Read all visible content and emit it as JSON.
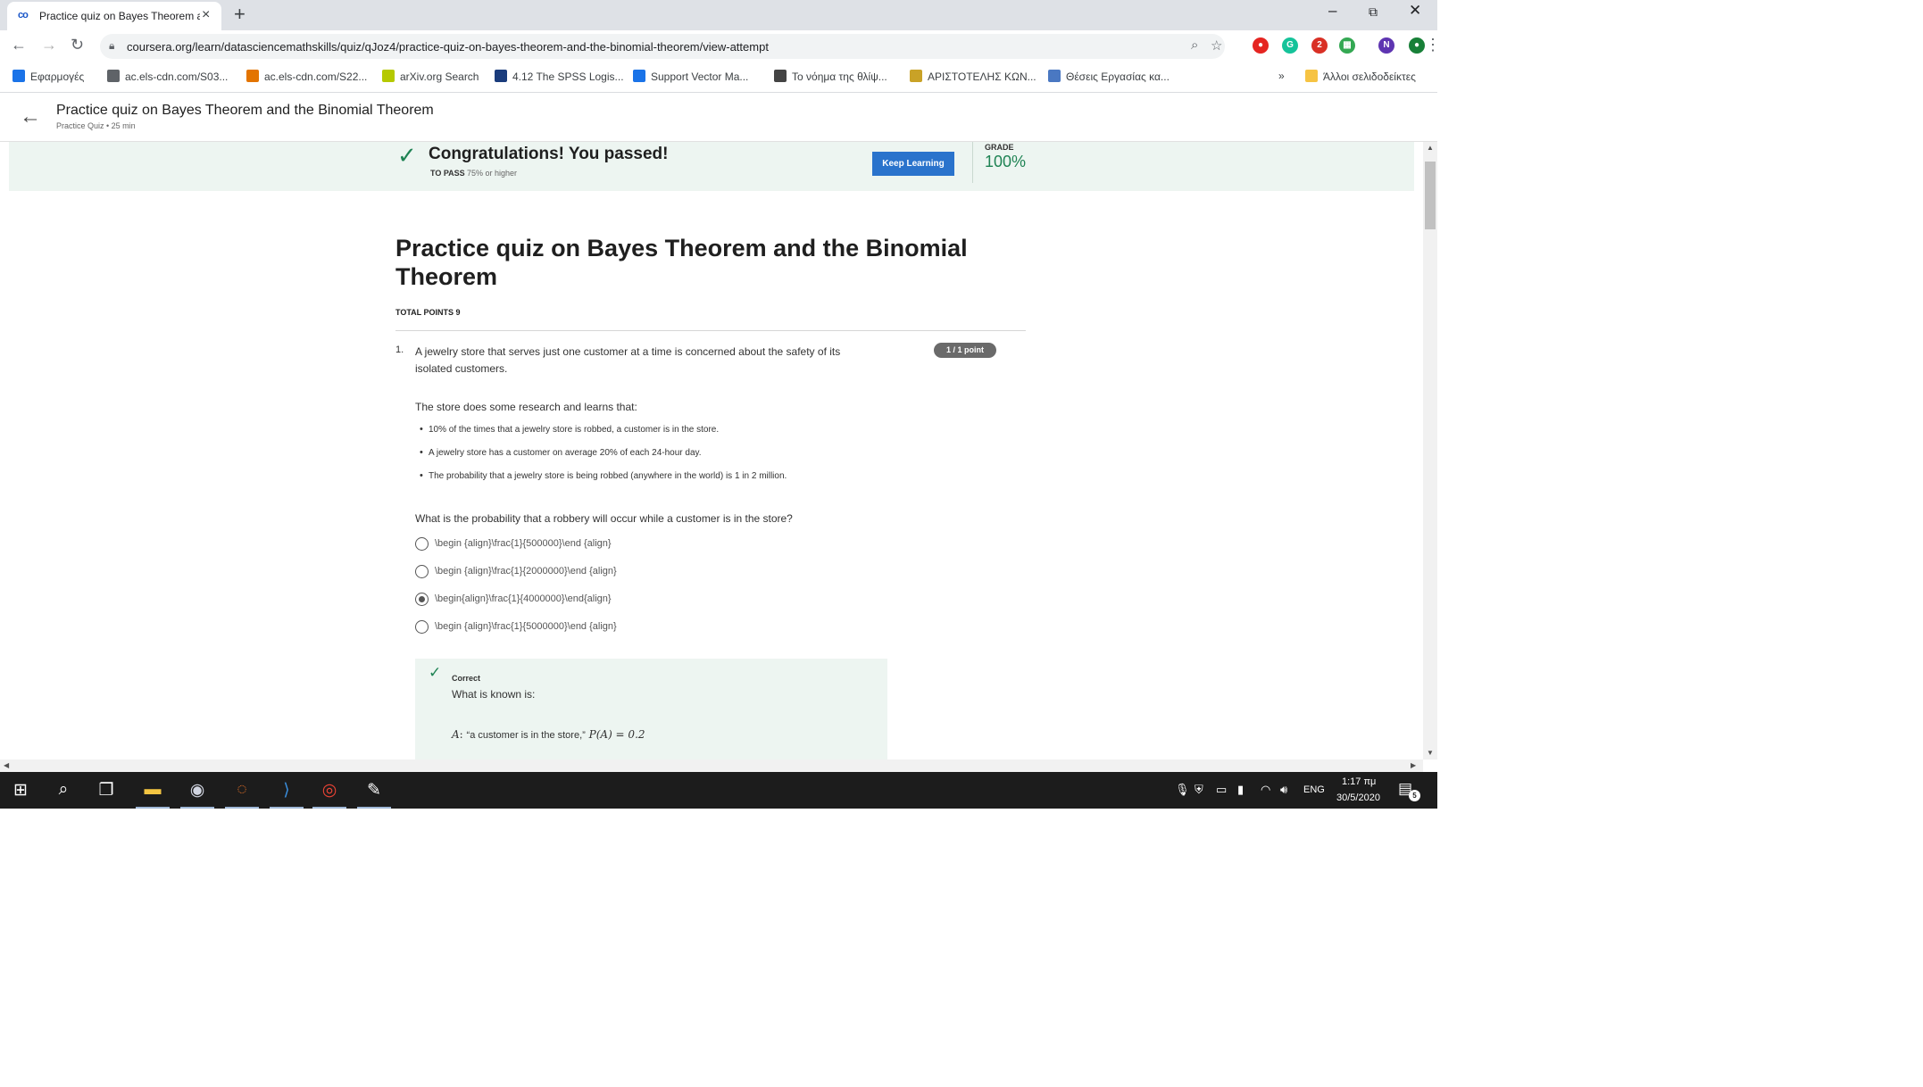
{
  "browser": {
    "tab": {
      "title": "Practice quiz on Bayes Theorem a",
      "favicon": "co"
    },
    "new_tab_glyph": "+",
    "window_controls": {
      "minimize": "–",
      "restore": "⧉",
      "close": "✕"
    },
    "url": "coursera.org/learn/datasciencemathskills/quiz/qJoz4/practice-quiz-on-bayes-theorem-and-the-binomial-theorem/view-attempt",
    "extensions": [
      {
        "name": "red-extension-icon",
        "color": "#e52521",
        "glyph": "●"
      },
      {
        "name": "grammarly-icon",
        "color": "#15c39a",
        "glyph": "G"
      },
      {
        "name": "shield-extension-icon",
        "color": "#d93025",
        "glyph": "2"
      },
      {
        "name": "puzzle-extension-icon",
        "color": "#34a853",
        "glyph": "▦"
      },
      {
        "name": "profile-avatar",
        "color": "#5e35b1",
        "glyph": "N"
      },
      {
        "name": "green-extension-icon",
        "color": "#188038",
        "glyph": "●"
      }
    ],
    "bookmarks": [
      {
        "label": "Εφαρμογές",
        "color": "#1a73e8"
      },
      {
        "label": "ac.els-cdn.com/S03...",
        "color": "#5f6368"
      },
      {
        "label": "ac.els-cdn.com/S22...",
        "color": "#e37400"
      },
      {
        "label": "arXiv.org Search",
        "color": "#b5c900"
      },
      {
        "label": "4.12 The SPSS Logis...",
        "color": "#1a3c7c"
      },
      {
        "label": "Support Vector Ma...",
        "color": "#1a73e8"
      },
      {
        "label": "Το νόημα της θλίψ...",
        "color": "#444444"
      },
      {
        "label": "ΑΡΙΣΤΟΤΕΛΗΣ ΚΩΝ...",
        "color": "#c9a227"
      },
      {
        "label": "Θέσεις Εργασίας κα...",
        "color": "#4a78c2"
      }
    ],
    "bookmarks_overflow": "»",
    "other_bookmarks": "Άλλοι σελιδοδείκτες"
  },
  "page": {
    "header": {
      "title": "Practice quiz on Bayes Theorem and the Binomial Theorem",
      "subtitle": "Practice Quiz • 25 min"
    },
    "banner": {
      "title": "Congratulations! You passed!",
      "to_pass_label": "TO PASS",
      "to_pass_value": "75% or higher",
      "keep_learning": "Keep Learning",
      "grade_label": "GRADE",
      "grade_value": "100%",
      "accent_color": "#1f8354"
    },
    "quiz": {
      "title": "Practice quiz on Bayes Theorem and the Binomial Theorem",
      "total_points": "TOTAL POINTS 9",
      "question": {
        "number": "1.",
        "points_badge": "1 / 1 point",
        "text": "A jewelry store that serves just one customer at a time is concerned about the safety of its isolated customers.",
        "intro": "The store does some research and learns that:",
        "bullets": [
          "10% of the times that a jewelry store is robbed, a customer is in the store.",
          "A jewelry store has a customer on average 20% of each 24-hour day.",
          "The probability that a jewelry store is being robbed (anywhere in the world) is 1 in 2 million."
        ],
        "ask": "What is the probability that a robbery will occur while a customer is in the store?",
        "options": [
          {
            "text": "\\begin {align}\\frac{1}{500000}\\end {align}",
            "selected": false
          },
          {
            "text": "\\begin {align}\\frac{1}{2000000}\\end {align}",
            "selected": false
          },
          {
            "text": "\\begin{align}\\frac{1}{4000000}\\end{align}",
            "selected": true
          },
          {
            "text": "\\begin {align}\\frac{1}{5000000}\\end {align}",
            "selected": false
          }
        ],
        "feedback": {
          "label": "Correct",
          "text": "What is known is:",
          "math_var": "A",
          "math_quote": "“a customer is in the store,”",
          "math_expr": "P(A) = 0.2"
        }
      }
    }
  },
  "taskbar": {
    "apps": [
      {
        "name": "start-button",
        "glyph": "⊞",
        "color": "#ffffff",
        "active": false
      },
      {
        "name": "search-icon",
        "glyph": "⌕",
        "color": "#ffffff",
        "active": false
      },
      {
        "name": "task-view-icon",
        "glyph": "❐",
        "color": "#ffffff",
        "active": false
      },
      {
        "name": "file-explorer-icon",
        "glyph": "▬",
        "color": "#f4c542",
        "active": true
      },
      {
        "name": "app-icon",
        "glyph": "◉",
        "color": "#d0d4e0",
        "active": true
      },
      {
        "name": "jupyter-icon",
        "glyph": "◌",
        "color": "#f37626",
        "active": true
      },
      {
        "name": "vscode-icon",
        "glyph": "⟩",
        "color": "#3a8ddb",
        "active": true
      },
      {
        "name": "chrome-icon",
        "glyph": "◎",
        "color": "#ea4335",
        "active": true
      },
      {
        "name": "paint-icon",
        "glyph": "✎",
        "color": "#ffffff",
        "active": true
      }
    ],
    "language": "ENG",
    "time": "1:17 πμ",
    "date": "30/5/2020",
    "notifications": "5"
  }
}
